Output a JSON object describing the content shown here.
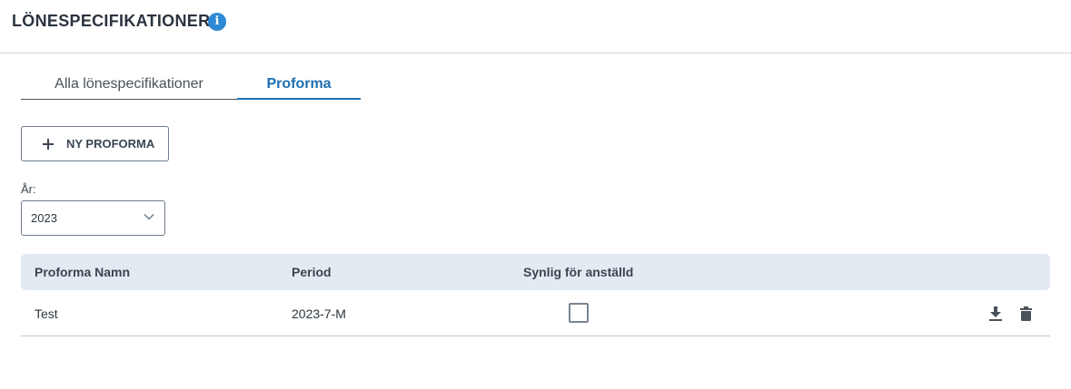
{
  "header": {
    "title": "LÖNESPECIFIKATIONER",
    "info_icon": "info-circle-icon"
  },
  "tabs": [
    {
      "label": "Alla lönespecifikationer",
      "active": false
    },
    {
      "label": "Proforma",
      "active": true
    }
  ],
  "toolbar": {
    "new_button_label": "NY PROFORMA",
    "new_button_icon": "plus-icon"
  },
  "year_filter": {
    "label": "År:",
    "value": "2023",
    "icon": "chevron-down-icon"
  },
  "table": {
    "columns": [
      "Proforma Namn",
      "Period",
      "Synlig för anställd"
    ],
    "rows": [
      {
        "name": "Test",
        "period": "2023-7-M",
        "visible_to_employee": false,
        "actions": [
          "download-icon",
          "trash-icon"
        ]
      }
    ]
  },
  "colors": {
    "accent": "#1f6fb3",
    "info_icon": "#2d89d3",
    "table_header_bg": "#e4eaf1",
    "text": "#2b3440"
  }
}
